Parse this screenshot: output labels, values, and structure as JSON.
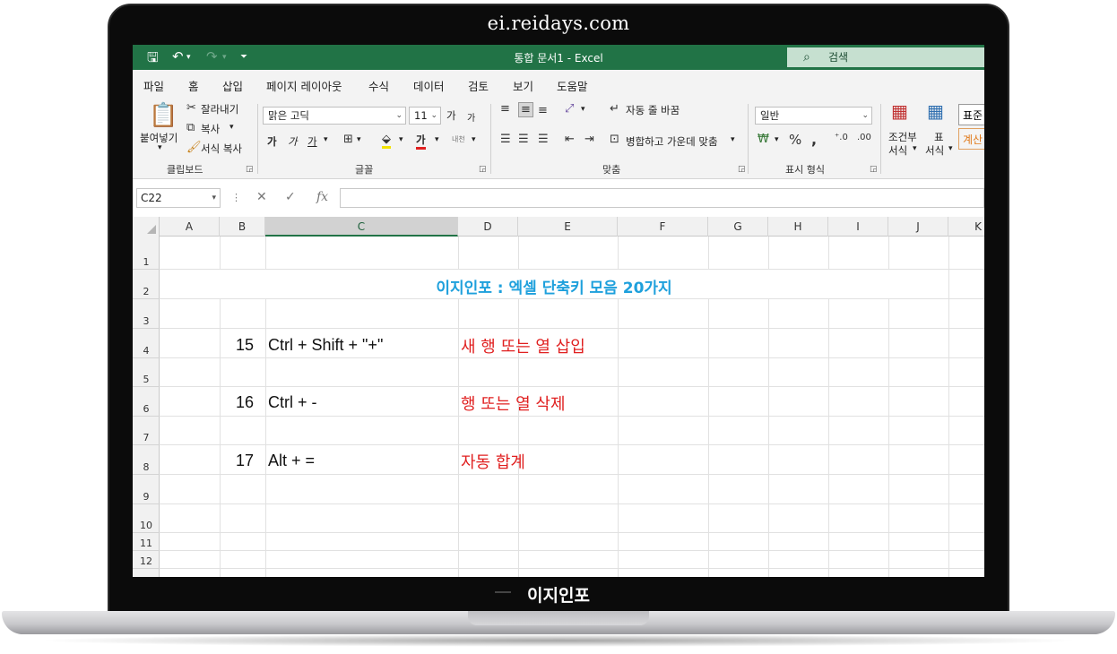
{
  "laptop": {
    "top_caption": "ei.reidays.com",
    "bottom_caption": "이지인포"
  },
  "titlebar": {
    "title": "통합 문서1  -  Excel",
    "search_placeholder": "검색",
    "accent_color": "#217346"
  },
  "menu": {
    "tabs": [
      {
        "label": "파일"
      },
      {
        "label": "홈",
        "active": true
      },
      {
        "label": "삽입"
      },
      {
        "label": "페이지 레이아웃"
      },
      {
        "label": "수식"
      },
      {
        "label": "데이터"
      },
      {
        "label": "검토"
      },
      {
        "label": "보기"
      },
      {
        "label": "도움말"
      }
    ]
  },
  "ribbon": {
    "clipboard": {
      "paste": "붙여넣기",
      "cut": "잘라내기",
      "copy": "복사",
      "format_painter": "서식 복사",
      "group_label": "클립보드"
    },
    "font": {
      "font_name": "맑은 고딕",
      "font_size": "11",
      "grow": "가",
      "shrink": "가",
      "bold": "가",
      "italic": "가",
      "underline": "가",
      "font_color_glyph": "가",
      "phonetic": "내천",
      "group_label": "글꼴"
    },
    "alignment": {
      "wrap_text": "자동 줄 바꿈",
      "merge_center": "병합하고 가운데 맞춤",
      "group_label": "맞춤"
    },
    "number": {
      "format": "일반",
      "group_label": "표시 형식"
    },
    "styles": {
      "conditional_1": "조건부",
      "conditional_2": "서식",
      "table_1": "표",
      "table_2": "서식",
      "style_normal": "표준",
      "style_calc": "계산"
    }
  },
  "formula_bar": {
    "name_box": "C22",
    "formula": ""
  },
  "sheet": {
    "columns": [
      "A",
      "B",
      "C",
      "D",
      "E",
      "F",
      "G",
      "H",
      "I",
      "J",
      "K"
    ],
    "selected_column": "C",
    "rows": [
      "1",
      "2",
      "3",
      "4",
      "5",
      "6",
      "7",
      "8",
      "9",
      "10",
      "11",
      "12"
    ],
    "title": "이지인포 : 엑셀 단축키 모음 20가지",
    "entries": [
      {
        "no": "15",
        "shortcut": "Ctrl + Shift + \"+\"",
        "desc": "새 행 또는 열 삽입"
      },
      {
        "no": "16",
        "shortcut": "Ctrl + -",
        "desc": "행 또는 열 삭제"
      },
      {
        "no": "17",
        "shortcut": "Alt + =",
        "desc": "자동 합계"
      }
    ]
  }
}
